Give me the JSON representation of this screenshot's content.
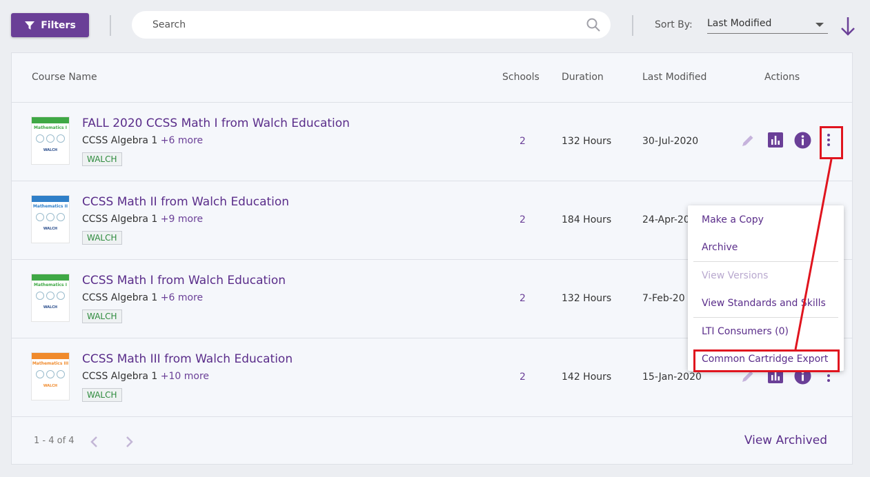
{
  "toolbar": {
    "filters_label": "Filters",
    "search_placeholder": "Search",
    "sort_label": "Sort By:",
    "sort_value": "Last Modified"
  },
  "table": {
    "headers": {
      "course_name": "Course Name",
      "schools": "Schools",
      "duration": "Duration",
      "last_modified": "Last Modified",
      "actions": "Actions"
    },
    "rows": [
      {
        "title": "FALL 2020 CCSS Math I from Walch Education",
        "subject": "CCSS Algebra 1",
        "more": "+6 more",
        "tag": "WALCH",
        "schools": "2",
        "duration": "132 Hours",
        "modified": "30-Jul-2020",
        "cover_title": "Mathematics I",
        "cover_color": "#3fa845"
      },
      {
        "title": "CCSS Math II from Walch Education",
        "subject": "CCSS Algebra 1",
        "more": "+9 more",
        "tag": "WALCH",
        "schools": "2",
        "duration": "184 Hours",
        "modified": "24-Apr-20",
        "cover_title": "Mathematics II",
        "cover_color": "#2f7fc8"
      },
      {
        "title": "CCSS Math I from Walch Education",
        "subject": "CCSS Algebra 1",
        "more": "+6 more",
        "tag": "WALCH",
        "schools": "2",
        "duration": "132 Hours",
        "modified": "7-Feb-20",
        "cover_title": "Mathematics I",
        "cover_color": "#3fa845"
      },
      {
        "title": "CCSS Math III from Walch Education",
        "subject": "CCSS Algebra 1",
        "more": "+10 more",
        "tag": "WALCH",
        "schools": "2",
        "duration": "142 Hours",
        "modified": "15-Jan-2020",
        "cover_title": "Mathematics III",
        "cover_color": "#f08a2b"
      }
    ],
    "footer": {
      "range": "1 - 4 of 4",
      "view_archived": "View Archived"
    }
  },
  "menu": {
    "items": [
      {
        "label": "Make a Copy",
        "enabled": true
      },
      {
        "label": "Archive",
        "enabled": true
      },
      {
        "label": "View Versions",
        "enabled": false
      },
      {
        "label": "View Standards and Skills",
        "enabled": true
      },
      {
        "label": "LTI Consumers (0)",
        "enabled": true
      },
      {
        "label": "Common Cartridge Export",
        "enabled": true
      }
    ]
  },
  "colors": {
    "accent": "#6a3f97",
    "highlight": "#e0141e",
    "tag_text": "#2e8b3d"
  },
  "icons": [
    "filter-icon",
    "search-icon",
    "sort-direction-arrow-icon",
    "edit-pencil-icon",
    "bar-chart-icon",
    "info-icon",
    "kebab-menu-icon",
    "chevron-left-icon",
    "chevron-right-icon"
  ]
}
